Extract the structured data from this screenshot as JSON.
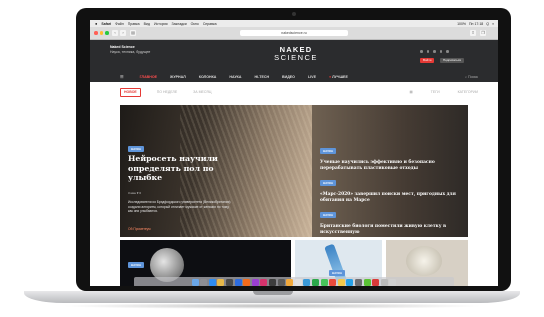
{
  "menubar": {
    "apple": "",
    "items": [
      "Safari",
      "Файл",
      "Правка",
      "Вид",
      "История",
      "Закладки",
      "Окно",
      "Справка"
    ],
    "right_items": [
      "100%",
      "Пн 17:18",
      "Q",
      "≡"
    ]
  },
  "browser": {
    "url": "nakedscience.ru"
  },
  "site": {
    "brand_mini_title": "Naked Science",
    "brand_mini_subtitle": "Наука, техника, будущее",
    "logo_line1": "NAKED",
    "logo_line2": "SCIENCE",
    "login_button": "Войти",
    "subscribe_button": "Подписаться",
    "nav": [
      "ГЛАВНОЕ",
      "ЖУРНАЛ",
      "КОЛОНКА",
      "НАУКА",
      "HI-TECH",
      "ВИДЕО",
      "LIVE",
      "ЛУЧШЕЕ"
    ],
    "search_label": "Поиск"
  },
  "filters": {
    "items": [
      "НОВОЕ",
      "ПО НЕДЕЛЕ",
      "ЗА МЕСЯЦ"
    ],
    "right": [
      "ТЕГИ",
      "КАТЕГОРИИ"
    ]
  },
  "hero": {
    "tag": "НАУКА",
    "title": "Нейросеть научили определять пол по улыбке",
    "meta": "3 мин   ♥ 0",
    "lead": "Исследователи из Брэдфордского университета (Великобритания) создали алгоритм, который отличает мужские от женских по тому, как они улыбаются.",
    "author": "Ой Прометеум"
  },
  "side": [
    {
      "tag": "НАУКА",
      "title": "Ученые научились эффективно и безопасно перерабатывать пластиковые отходы"
    },
    {
      "tag": "НАУКА",
      "title": "«Марс-2020» завершил поиски мест, пригодных для обитания на Марсе"
    },
    {
      "tag": "НАУКА",
      "title": "Британские биологи поместили живую клетку в искусственную"
    }
  ],
  "cards": [
    {
      "tag": "НАУКА"
    },
    {
      "tag": "НАУКА"
    },
    {
      "tag": ""
    }
  ],
  "colors": {
    "accent": "#e53935",
    "tag": "#5e94d9",
    "header_bg": "#2b2c2e"
  }
}
